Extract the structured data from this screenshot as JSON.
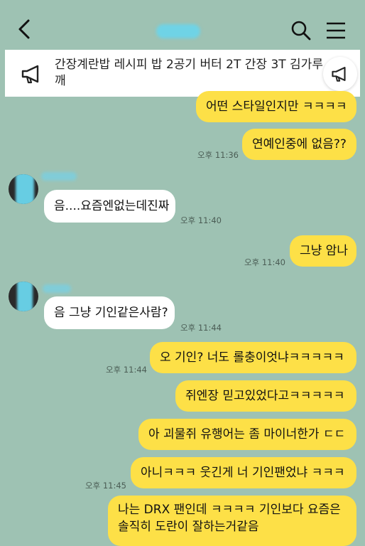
{
  "header": {
    "back_icon": "chevron-left-icon",
    "search_icon": "search-icon",
    "menu_icon": "hamburger-menu-icon"
  },
  "notice": {
    "icon": "megaphone-icon",
    "text": "간장계란밥 레시피 밥 2공기 버터 2T 간장 3T 김가루 깨"
  },
  "colors": {
    "background": "#9ec2b3",
    "mine_bubble": "#fde047",
    "theirs_bubble": "#ffffff"
  },
  "messages": [
    {
      "from": "me",
      "text": "어떤 스타일인지만 ㅋㅋㅋㅋ"
    },
    {
      "from": "me",
      "text": "연예인중에 없음??",
      "time": "오후 11:36"
    },
    {
      "from": "other",
      "text": "음....요즘엔없는데진짜",
      "time": "오후 11:40"
    },
    {
      "from": "me",
      "text": "그냥 암나",
      "time": "오후 11:40"
    },
    {
      "from": "other",
      "text": "음 그냥 기인같은사람?",
      "time": "오후 11:44"
    },
    {
      "from": "me",
      "text": "오 기인? 너도 롤충이엇냐ㅋㅋㅋㅋㅋ",
      "time": "오후 11:44"
    },
    {
      "from": "me",
      "text": "쥐엔장 믿고있었다고ㅋㅋㅋㅋㅋ"
    },
    {
      "from": "me",
      "text": "아 괴물쥐 유행어는 좀 마이너한가 ㄷㄷ"
    },
    {
      "from": "me",
      "text": "아니ㅋㅋㅋ 웃긴게 너 기인팬었냐 ㅋㅋㅋ",
      "time": "오후 11:45"
    },
    {
      "from": "me",
      "text": "나는 DRX 팬인데 ㅋㅋㅋㅋ 기인보다 요즘은 솔직히 도란이 잘하는거같음"
    }
  ]
}
